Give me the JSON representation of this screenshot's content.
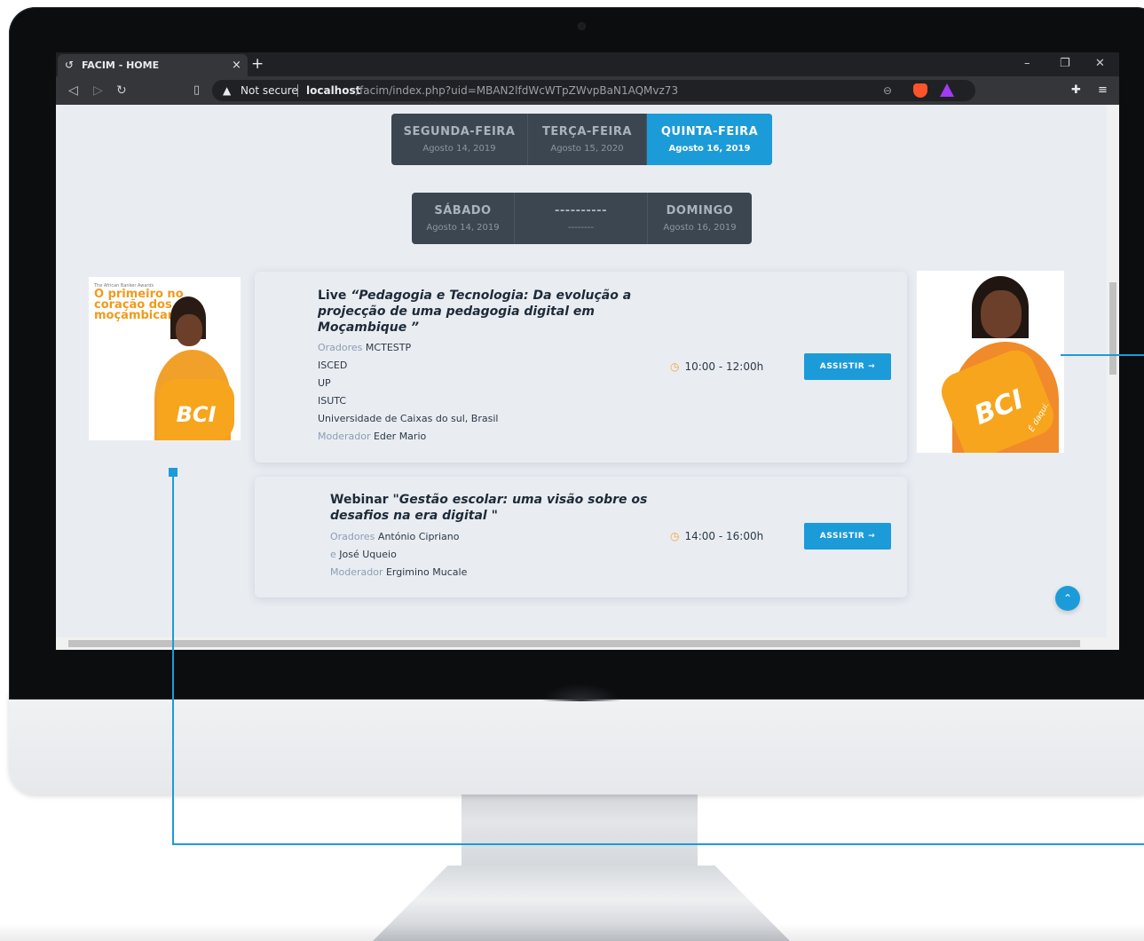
{
  "browser": {
    "tab_title": "FACIM - HOME",
    "tab_close": "×",
    "new_tab": "+",
    "security_label": "Not secure",
    "url_host": "localhost",
    "url_path": "/facim/index.php?uid=MBAN2lfdWcWTpZWvpBaN1AQMvz73",
    "window_controls": [
      "–",
      "❐",
      "✕"
    ]
  },
  "days_row1": [
    {
      "name": "SEGUNDA-FEIRA",
      "date": "Agosto 14, 2019",
      "active": false
    },
    {
      "name": "TERÇA-FEIRA",
      "date": "Agosto 15, 2020",
      "active": false
    },
    {
      "name": "QUINTA-FEIRA",
      "date": "Agosto 16, 2019",
      "active": true
    }
  ],
  "days_row2": [
    {
      "name": "SÁBADO",
      "date": "Agosto 14, 2019"
    },
    {
      "name": "----------",
      "date": "--------"
    },
    {
      "name": "DOMINGO",
      "date": "Agosto 16, 2019"
    }
  ],
  "sessions": [
    {
      "type": "Live",
      "title_lines": [
        "“Pedagogia e Tecnologia: Da evolução a",
        "projecção de uma pedagogia digital em",
        "Moçambique ”"
      ],
      "lines": [
        {
          "label": "Oradores",
          "value": "MCTESTP"
        },
        {
          "label": "",
          "value": "ISCED"
        },
        {
          "label": "",
          "value": "UP"
        },
        {
          "label": "",
          "value": "ISUTC"
        },
        {
          "label": "",
          "value": "Universidade de Caixas do sul, Brasil"
        },
        {
          "label": "Moderador",
          "value": "Eder Mario"
        }
      ],
      "time": "10:00 - 12:00h",
      "button": "ASSISTIR →"
    },
    {
      "type": "Webinar",
      "title_lines": [
        "\"Gestão escolar: uma visão sobre os",
        "desafios na era digital \""
      ],
      "lines": [
        {
          "label": "Oradores",
          "value": "António Cipriano"
        },
        {
          "label": "e",
          "value": "José Uqueio"
        },
        {
          "label": "Moderador",
          "value": "Ergimino Mucale"
        }
      ],
      "time": "14:00 - 16:00h",
      "button": "ASSISTIR →"
    }
  ],
  "ads": {
    "left_small": "The African Banker Awards",
    "left_headline": "O primeiro no coração dos moçambicanos",
    "brand": "BCI",
    "right_tagline": "É daqui."
  },
  "colors": {
    "accent": "#1c9bd9",
    "daybar": "#3b4651",
    "brand_orange": "#f7a51d"
  }
}
